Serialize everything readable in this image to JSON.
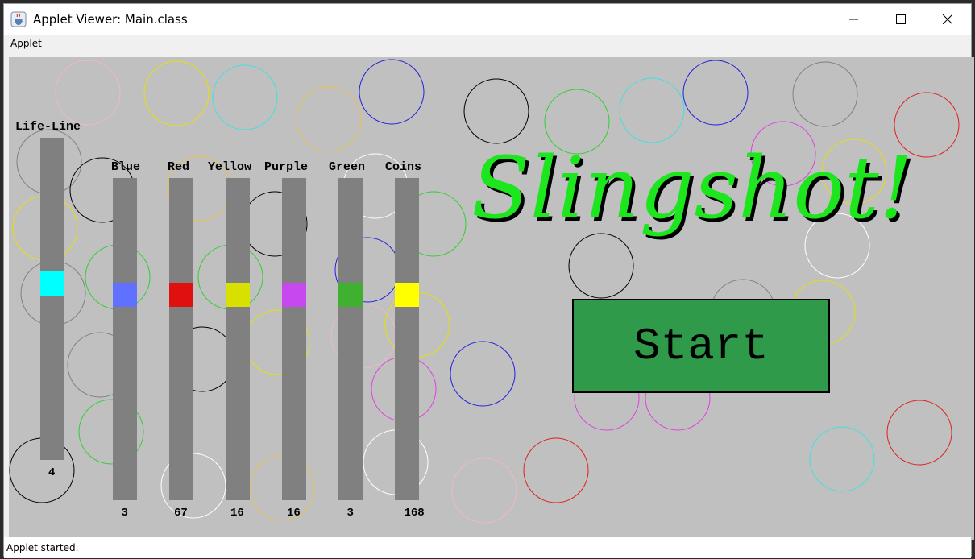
{
  "window": {
    "title": "Applet Viewer: Main.class"
  },
  "menu": {
    "items": [
      "Applet"
    ]
  },
  "status": {
    "text": "Applet started."
  },
  "game": {
    "title": "Slingshot!",
    "title_color": "#1ee61e",
    "start_label": "Start",
    "start_color": "#2e9a4a",
    "lifeline": {
      "label": "Life-Line",
      "value": "4",
      "marker_color": "#00ffff",
      "level": 0.55
    },
    "meters": [
      {
        "label": "Blue",
        "value": "3",
        "marker_color": "#6070ff",
        "level": 0.65
      },
      {
        "label": "Red",
        "value": "67",
        "marker_color": "#e01010",
        "level": 0.65
      },
      {
        "label": "Yellow",
        "value": "16",
        "marker_color": "#d8e000",
        "level": 0.65
      },
      {
        "label": "Purple",
        "value": "16",
        "marker_color": "#c848f0",
        "level": 0.65
      },
      {
        "label": "Green",
        "value": "3",
        "marker_color": "#40b030",
        "level": 0.65
      },
      {
        "label": "Coins",
        "value": "168",
        "marker_color": "#ffff00",
        "level": 0.65
      }
    ]
  }
}
